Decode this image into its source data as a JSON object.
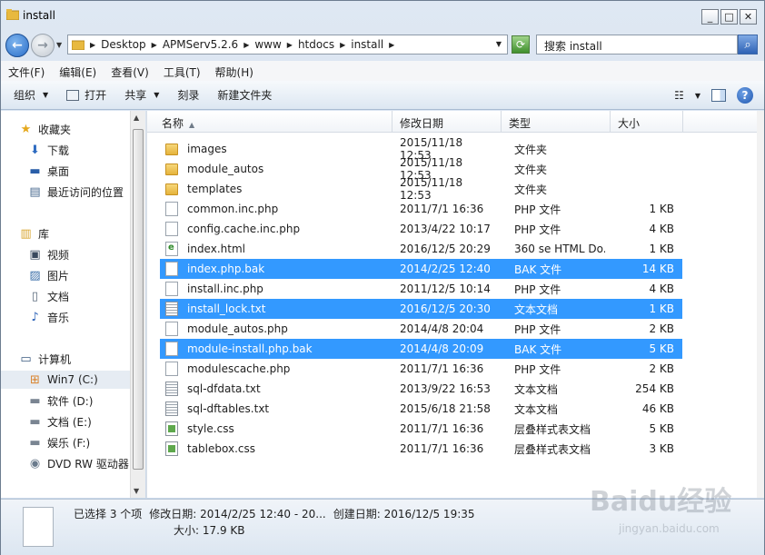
{
  "window": {
    "title": "install"
  },
  "address": {
    "crumbs": [
      "Desktop",
      "APMServ5.2.6",
      "www",
      "htdocs",
      "install"
    ],
    "search_placeholder": "搜索 install"
  },
  "menubar": [
    "文件(F)",
    "编辑(E)",
    "查看(V)",
    "工具(T)",
    "帮助(H)"
  ],
  "toolbar": {
    "organize": "组织",
    "open": "打开",
    "share": "共享",
    "burn": "刻录",
    "new_folder": "新建文件夹"
  },
  "navpane": {
    "favorites": "收藏夹",
    "downloads": "下载",
    "desktop": "桌面",
    "recent": "最近访问的位置",
    "libraries": "库",
    "videos": "视频",
    "pictures": "图片",
    "documents": "文档",
    "music": "音乐",
    "computer": "计算机",
    "drive_c": "Win7 (C:)",
    "drive_d": "软件 (D:)",
    "drive_e": "文档 (E:)",
    "drive_f": "娱乐 (F:)",
    "drive_dvd": "DVD RW 驱动器"
  },
  "columns": {
    "name": "名称",
    "date": "修改日期",
    "type": "类型",
    "size": "大小"
  },
  "files": [
    {
      "name": "images",
      "date": "2015/11/18 12:53",
      "type": "文件夹",
      "size": "",
      "icon": "folder",
      "selected": false
    },
    {
      "name": "module_autos",
      "date": "2015/11/18 12:53",
      "type": "文件夹",
      "size": "",
      "icon": "folder",
      "selected": false
    },
    {
      "name": "templates",
      "date": "2015/11/18 12:53",
      "type": "文件夹",
      "size": "",
      "icon": "folder",
      "selected": false
    },
    {
      "name": "common.inc.php",
      "date": "2011/7/1 16:36",
      "type": "PHP 文件",
      "size": "1 KB",
      "icon": "file",
      "selected": false
    },
    {
      "name": "config.cache.inc.php",
      "date": "2013/4/22 10:17",
      "type": "PHP 文件",
      "size": "4 KB",
      "icon": "file",
      "selected": false
    },
    {
      "name": "index.html",
      "date": "2016/12/5 20:29",
      "type": "360 se HTML Do...",
      "size": "1 KB",
      "icon": "html",
      "selected": false
    },
    {
      "name": "index.php.bak",
      "date": "2014/2/25 12:40",
      "type": "BAK 文件",
      "size": "14 KB",
      "icon": "file",
      "selected": true
    },
    {
      "name": "install.inc.php",
      "date": "2011/12/5 10:14",
      "type": "PHP 文件",
      "size": "4 KB",
      "icon": "file",
      "selected": false
    },
    {
      "name": "install_lock.txt",
      "date": "2016/12/5 20:30",
      "type": "文本文档",
      "size": "1 KB",
      "icon": "text",
      "selected": true
    },
    {
      "name": "module_autos.php",
      "date": "2014/4/8 20:04",
      "type": "PHP 文件",
      "size": "2 KB",
      "icon": "file",
      "selected": false
    },
    {
      "name": "module-install.php.bak",
      "date": "2014/4/8 20:09",
      "type": "BAK 文件",
      "size": "5 KB",
      "icon": "file",
      "selected": true
    },
    {
      "name": "modulescache.php",
      "date": "2011/7/1 16:36",
      "type": "PHP 文件",
      "size": "2 KB",
      "icon": "file",
      "selected": false
    },
    {
      "name": "sql-dfdata.txt",
      "date": "2013/9/22 16:53",
      "type": "文本文档",
      "size": "254 KB",
      "icon": "text",
      "selected": false
    },
    {
      "name": "sql-dftables.txt",
      "date": "2015/6/18 21:58",
      "type": "文本文档",
      "size": "46 KB",
      "icon": "text",
      "selected": false
    },
    {
      "name": "style.css",
      "date": "2011/7/1 16:36",
      "type": "层叠样式表文档",
      "size": "5 KB",
      "icon": "css",
      "selected": false
    },
    {
      "name": "tablebox.css",
      "date": "2011/7/1 16:36",
      "type": "层叠样式表文档",
      "size": "3 KB",
      "icon": "css",
      "selected": false
    }
  ],
  "details": {
    "selected": "已选择 3 个项",
    "modified": "修改日期: 2014/2/25 12:40 - 20...",
    "created": "创建日期: 2016/12/5 19:35",
    "size": "大小: 17.9 KB"
  },
  "watermark": {
    "logo": "Baidu经验",
    "url": "jingyan.baidu.com"
  },
  "colors": {
    "selection": "#3399ff",
    "chrome": "#c9d7e8"
  }
}
